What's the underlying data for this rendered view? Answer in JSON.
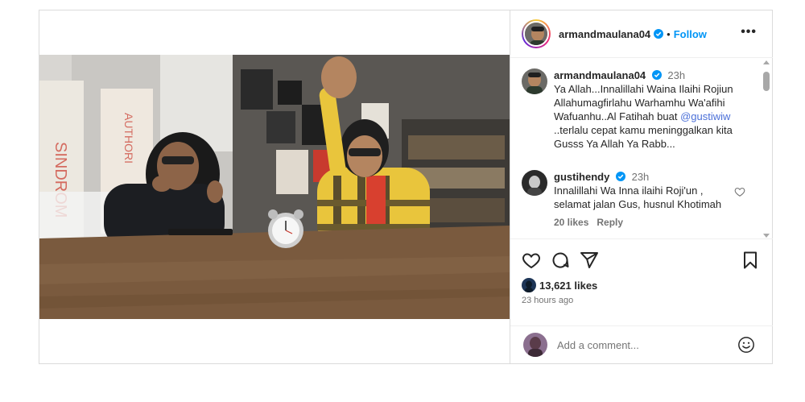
{
  "post": {
    "author": "armandmaulana04",
    "follow_label": "Follow",
    "dot": "•",
    "more_label": "•••"
  },
  "comments": [
    {
      "user": "armandmaulana04",
      "time": "23h",
      "text_before": "Ya Allah...Innalillahi Waina Ilaihi Rojiun Allahumagfirlahu Warhamhu Wa'afihi Wafuanhu..Al Fatihah buat ",
      "mention": "@gustiwiw",
      "text_after": " ..terlalu cepat kamu meninggalkan kita Gusss Ya Allah Ya Rabb..."
    },
    {
      "user": "gustihendy",
      "time": "23h",
      "text": "Innalillahi Wa Inna ilaihi Roji'un , selamat jalan Gus, husnul Khotimah",
      "likes": "20 likes",
      "reply_label": "Reply"
    }
  ],
  "stats": {
    "likes": "13,621 likes",
    "time_ago": "23 hours ago"
  },
  "composer": {
    "placeholder": "Add a comment..."
  },
  "icons": {
    "like": "heart-icon",
    "comment": "comment-icon",
    "share": "send-icon",
    "save": "bookmark-icon",
    "emoji": "emoji-icon",
    "verified": "verified-badge-icon"
  },
  "colors": {
    "accent": "#0095f6",
    "verified": "#0095f6",
    "mention": "#4a6fd8",
    "border": "#dbdbdb",
    "muted": "#737373"
  }
}
